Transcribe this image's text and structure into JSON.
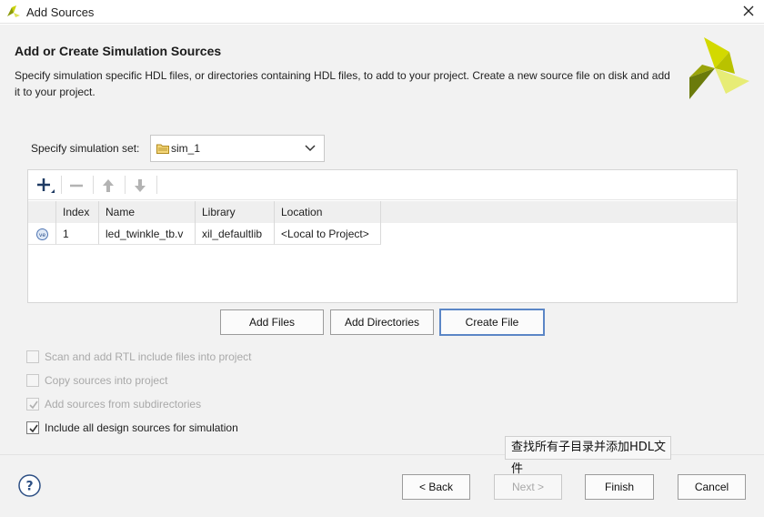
{
  "window": {
    "title": "Add Sources",
    "close_icon": "close-icon",
    "app_icon": "vivado-logo-icon"
  },
  "header": {
    "heading": "Add or Create Simulation Sources",
    "description": "Specify simulation specific HDL files, or directories containing HDL files, to add to your project. Create a new source file on disk and add it to your project.",
    "logo_icon": "vivado-brand-logo",
    "logo_colors": [
      "#d3d900",
      "#9aa40a",
      "#6b7b0b",
      "#e7ec76"
    ]
  },
  "simset": {
    "label": "Specify simulation set:",
    "value": "sim_1",
    "icon": "folder-icon"
  },
  "toolbar": {
    "add_icon": "plus-icon",
    "remove_icon": "minus-icon",
    "up_icon": "arrow-up-icon",
    "down_icon": "arrow-down-icon"
  },
  "table": {
    "columns": [
      "Index",
      "Name",
      "Library",
      "Location"
    ],
    "rows": [
      {
        "icon": "verilog-file-icon",
        "index": "1",
        "name": "led_twinkle_tb.v",
        "library": "xil_defaultlib",
        "location": "<Local to Project>"
      }
    ]
  },
  "actions": {
    "add_files": "Add Files",
    "add_directories": "Add Directories",
    "create_file": "Create File"
  },
  "options": [
    {
      "label": "Scan and add RTL include files into project",
      "checked": false,
      "enabled": false
    },
    {
      "label": "Copy sources into project",
      "checked": false,
      "enabled": false
    },
    {
      "label": "Add sources from subdirectories",
      "checked": true,
      "enabled": false
    },
    {
      "label": "Include all design sources for simulation",
      "checked": true,
      "enabled": true
    }
  ],
  "tooltip": {
    "text": "查找所有子目录并添加HDL文件"
  },
  "footer": {
    "help_icon": "help-icon",
    "help_glyph": "?",
    "back": "< Back",
    "next": "Next >",
    "finish": "Finish",
    "cancel": "Cancel"
  },
  "colors": {
    "accent_border": "#5b86c6",
    "background": "#f2f2f2",
    "checkmark": "#333333"
  }
}
